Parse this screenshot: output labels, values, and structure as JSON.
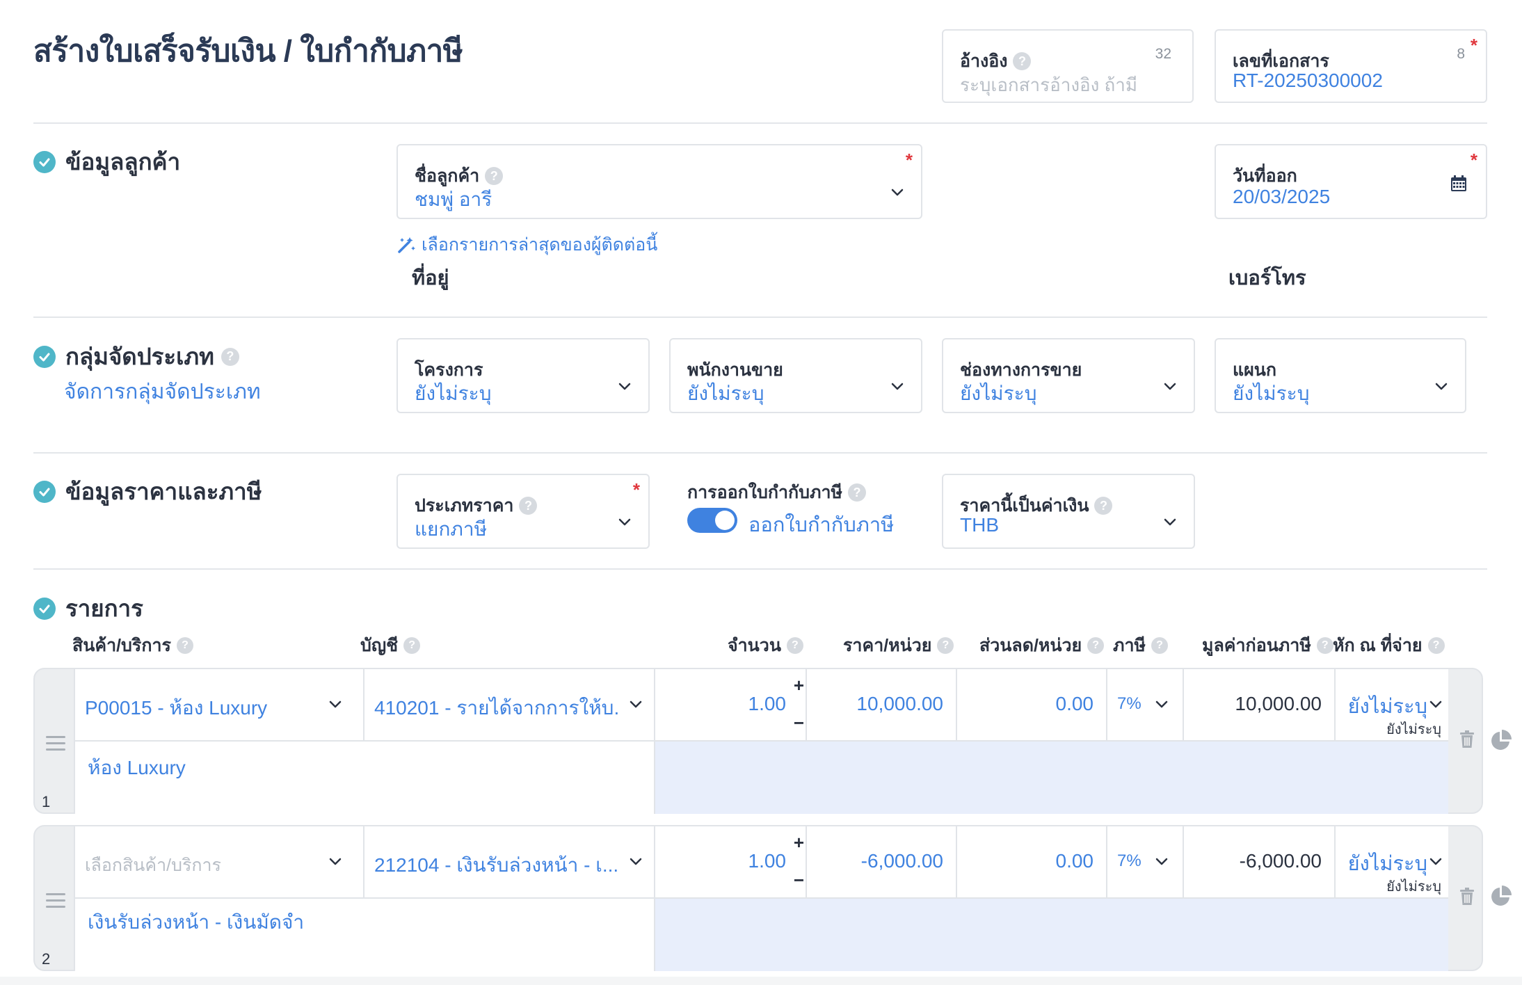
{
  "page": {
    "title": "สร้างใบเสร็จรับเงิน / ใบกำกับภาษี"
  },
  "header": {
    "reference": {
      "label": "อ้างอิง",
      "counter": "32",
      "placeholder": "ระบุเอกสารอ้างอิง ถ้ามี"
    },
    "doc_number": {
      "label": "เลขที่เอกสาร",
      "counter": "8",
      "required": "*",
      "value": "RT-20250300002"
    }
  },
  "customer": {
    "section_title": "ข้อมูลลูกค้า",
    "name": {
      "label": "ชื่อลูกค้า",
      "required": "*",
      "value": "ชมพู่ อารี"
    },
    "recent_link": "เลือกรายการล่าสุดของผู้ติดต่อนี้",
    "address_label": "ที่อยู่",
    "phone_label": "เบอร์โทร",
    "issue_date": {
      "label": "วันที่ออก",
      "required": "*",
      "value": "20/03/2025"
    }
  },
  "grouping": {
    "section_title": "กลุ่มจัดประเภท",
    "manage_link": "จัดการกลุ่มจัดประเภท",
    "fields": [
      {
        "label": "โครงการ",
        "value": "ยังไม่ระบุ"
      },
      {
        "label": "พนักงานขาย",
        "value": "ยังไม่ระบุ"
      },
      {
        "label": "ช่องทางการขาย",
        "value": "ยังไม่ระบุ"
      },
      {
        "label": "แผนก",
        "value": "ยังไม่ระบุ"
      }
    ]
  },
  "pricing": {
    "section_title": "ข้อมูลราคาและภาษี",
    "price_type": {
      "label": "ประเภทราคา",
      "required": "*",
      "value": "แยกภาษี"
    },
    "tax_invoice": {
      "label": "การออกใบกำกับภาษี",
      "toggle_label": "ออกใบกำกับภาษี",
      "enabled": true
    },
    "currency": {
      "label": "ราคานี้เป็นค่าเงิน",
      "value": "THB"
    }
  },
  "items": {
    "section_title": "รายการ",
    "columns": {
      "product": "สินค้า/บริการ",
      "account": "บัญชี",
      "qty": "จำนวน",
      "unit_price": "ราคา/หน่วย",
      "discount": "ส่วนลด/หน่วย",
      "tax": "ภาษี",
      "pre_tax": "มูลค่าก่อนภาษี",
      "wht": "หัก ณ ที่จ่าย"
    },
    "plus": "+",
    "minus": "−",
    "rows": [
      {
        "num": "1",
        "product": "P00015 - ห้อง Luxury",
        "product_placeholder": false,
        "account": "410201 - รายได้จากการให้บ...",
        "qty": "1.00",
        "unit_price": "10,000.00",
        "discount": "0.00",
        "tax": "7%",
        "pre_tax": "10,000.00",
        "wht": "ยังไม่ระบุ",
        "wht_sub": "ยังไม่ระบุ",
        "description": "ห้อง Luxury"
      },
      {
        "num": "2",
        "product": "เลือกสินค้า/บริการ",
        "product_placeholder": true,
        "account": "212104 - เงินรับล่วงหน้า - เ...",
        "qty": "1.00",
        "unit_price": "-6,000.00",
        "discount": "0.00",
        "tax": "7%",
        "pre_tax": "-6,000.00",
        "wht": "ยังไม่ระบุ",
        "wht_sub": "ยังไม่ระบุ",
        "description": "เงินรับล่วงหน้า - เงินมัดจำ"
      }
    ]
  },
  "colors": {
    "accent": "#3f82e0",
    "check": "#4fb6c8",
    "required": "#e0383e",
    "description_bg": "#e8eefb"
  }
}
